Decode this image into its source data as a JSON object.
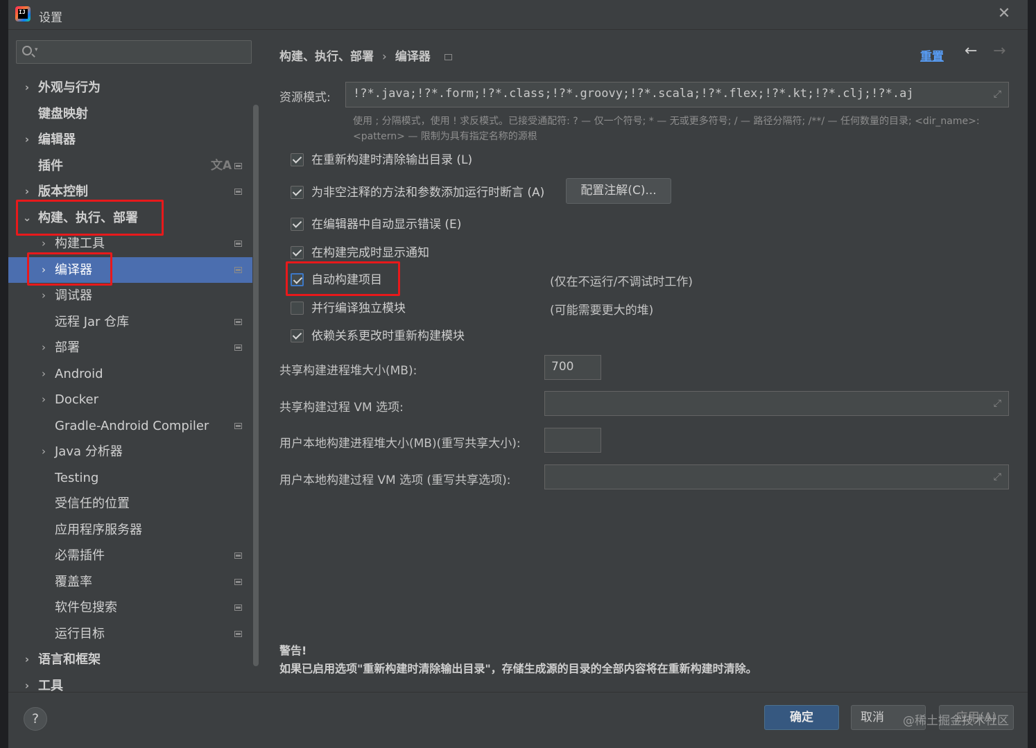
{
  "window": {
    "title": "设置"
  },
  "search": {
    "placeholder": ""
  },
  "sidebar": {
    "items": [
      {
        "label": "外观与行为",
        "expandable": true,
        "level": 0,
        "bold": true
      },
      {
        "label": "键盘映射",
        "expandable": false,
        "level": 0,
        "bold": true
      },
      {
        "label": "编辑器",
        "expandable": true,
        "level": 0,
        "bold": true
      },
      {
        "label": "插件",
        "expandable": false,
        "level": 0,
        "bold": true
      },
      {
        "label": "版本控制",
        "expandable": true,
        "level": 0,
        "bold": true
      },
      {
        "label": "构建、执行、部署",
        "expandable": true,
        "expanded": true,
        "level": 0,
        "bold": true
      },
      {
        "label": "构建工具",
        "expandable": true,
        "level": 1
      },
      {
        "label": "编译器",
        "expandable": true,
        "level": 1,
        "selected": true
      },
      {
        "label": "调试器",
        "expandable": true,
        "level": 1
      },
      {
        "label": "远程 Jar 仓库",
        "expandable": false,
        "level": 1
      },
      {
        "label": "部署",
        "expandable": true,
        "level": 1
      },
      {
        "label": "Android",
        "expandable": true,
        "level": 1
      },
      {
        "label": "Docker",
        "expandable": true,
        "level": 1
      },
      {
        "label": "Gradle-Android Compiler",
        "expandable": false,
        "level": 1
      },
      {
        "label": "Java 分析器",
        "expandable": true,
        "level": 1
      },
      {
        "label": "Testing",
        "expandable": false,
        "level": 1
      },
      {
        "label": "受信任的位置",
        "expandable": false,
        "level": 1
      },
      {
        "label": "应用程序服务器",
        "expandable": false,
        "level": 1
      },
      {
        "label": "必需插件",
        "expandable": false,
        "level": 1
      },
      {
        "label": "覆盖率",
        "expandable": false,
        "level": 1
      },
      {
        "label": "软件包搜索",
        "expandable": false,
        "level": 1
      },
      {
        "label": "运行目标",
        "expandable": false,
        "level": 1
      },
      {
        "label": "语言和框架",
        "expandable": true,
        "level": 0,
        "bold": true
      },
      {
        "label": "工具",
        "expandable": true,
        "level": 0,
        "bold": true
      }
    ]
  },
  "breadcrumb": {
    "parent": "构建、执行、部署",
    "separator": "›",
    "current": "编译器"
  },
  "header": {
    "reset_label": "重置",
    "back_icon": "arrow-left-icon",
    "forward_icon": "arrow-right-icon"
  },
  "resource_patterns": {
    "label": "资源模式:",
    "value": "!?*.java;!?*.form;!?*.class;!?*.groovy;!?*.scala;!?*.flex;!?*.kt;!?*.clj;!?*.aj",
    "hint": "使用 ; 分隔模式，使用 ! 求反模式。已接受通配符: ? — 仅一个符号; * — 无或更多符号; / — 路径分隔符; /**/ — 任何数量的目录; <dir_name>:<pattern> — 限制为具有指定名称的源根"
  },
  "options": {
    "clear_output": {
      "label": "在重新构建时清除输出目录 (L)",
      "checked": true
    },
    "not_null_assertions": {
      "label": "为非空注释的方法和参数添加运行时断言 (A)",
      "checked": true
    },
    "configure_annotations_label": "配置注解(C)...",
    "auto_show_errors": {
      "label": "在编辑器中自动显示错误 (E)",
      "checked": true
    },
    "notify_on_build": {
      "label": "在构建完成时显示通知",
      "checked": true
    },
    "auto_build": {
      "label": "自动构建项目",
      "checked": true,
      "note": "(仅在不运行/不调试时工作)"
    },
    "parallel_compile": {
      "label": "并行编译独立模块",
      "checked": false,
      "note": "(可能需要更大的堆)"
    },
    "rebuild_on_dependency_change": {
      "label": "依赖关系更改时重新构建模块",
      "checked": true
    }
  },
  "fields": {
    "shared_heap": {
      "label": "共享构建进程堆大小(MB):",
      "value": "700"
    },
    "shared_vm": {
      "label": "共享构建过程 VM 选项:",
      "value": ""
    },
    "user_heap": {
      "label": "用户本地构建进程堆大小(MB)(重写共享大小):",
      "value": ""
    },
    "user_vm": {
      "label": "用户本地构建过程 VM 选项 (重写共享选项):",
      "value": ""
    }
  },
  "warning": {
    "title": "警告!",
    "text": "如果已启用选项\"重新构建时清除输出目录\"，存储生成源的目录的全部内容将在重新构建时清除。"
  },
  "footer": {
    "help_label": "?",
    "ok_label": "确定",
    "cancel_label": "取消",
    "apply_label": "应用(A)",
    "watermark": "@稀土掘金技术社区"
  },
  "colors": {
    "selection": "#4b6eaf",
    "link": "#589df6",
    "highlight_box": "#e8191b",
    "primary_button": "#365880"
  }
}
